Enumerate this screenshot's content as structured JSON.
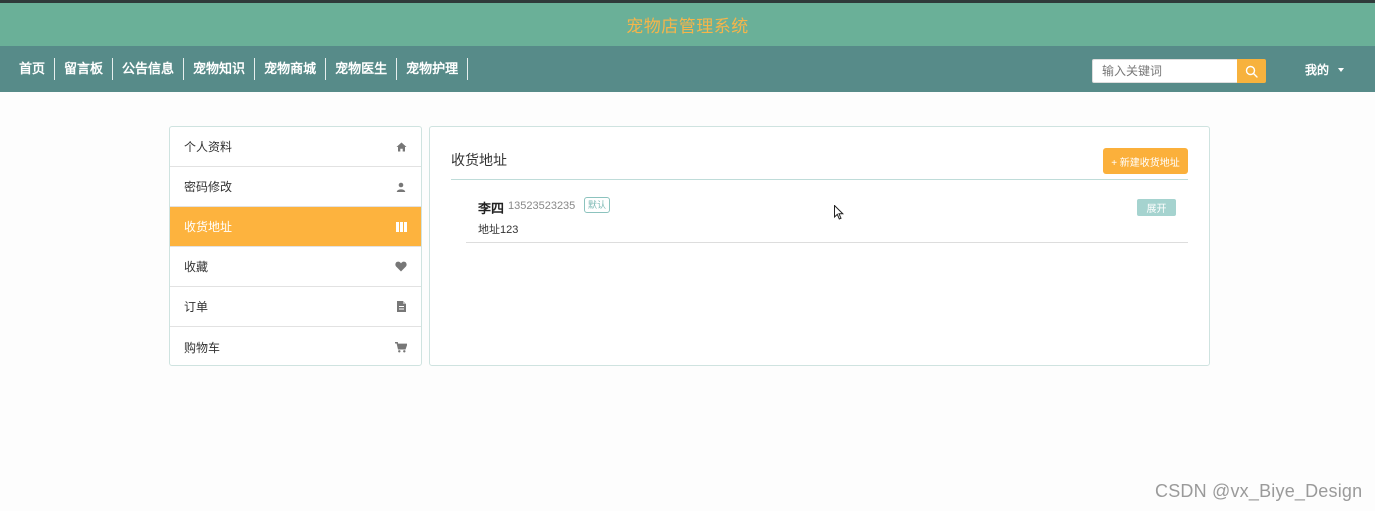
{
  "app": {
    "title": "宠物店管理系统"
  },
  "nav": {
    "items": [
      "首页",
      "留言板",
      "公告信息",
      "宠物知识",
      "宠物商城",
      "宠物医生",
      "宠物护理"
    ],
    "search_placeholder": "输入关键词",
    "search_icon": "search-icon",
    "user_menu_label": "我的"
  },
  "sidebar": {
    "items": [
      {
        "label": "个人资料",
        "icon": "home-icon",
        "active": false
      },
      {
        "label": "密码修改",
        "icon": "user-icon",
        "active": false
      },
      {
        "label": "收货地址",
        "icon": "columns-icon",
        "active": true
      },
      {
        "label": "收藏",
        "icon": "heart-icon",
        "active": false
      },
      {
        "label": "订单",
        "icon": "file-icon",
        "active": false
      },
      {
        "label": "购物车",
        "icon": "cart-icon",
        "active": false
      }
    ]
  },
  "main": {
    "title": "收货地址",
    "new_button_label": "+ 新建收货地址",
    "addresses": [
      {
        "name": "李四",
        "phone": "13523523235",
        "badge": "默认",
        "address": "地址123",
        "expand_label": "展开"
      }
    ]
  },
  "watermark": "CSDN @vx_Biye_Design",
  "colors": {
    "title_bar": "#6ab098",
    "title_text": "#f5b54a",
    "nav_bar": "#578b89",
    "accent": "#fdb33e",
    "expand_button": "#a5d3cf"
  }
}
